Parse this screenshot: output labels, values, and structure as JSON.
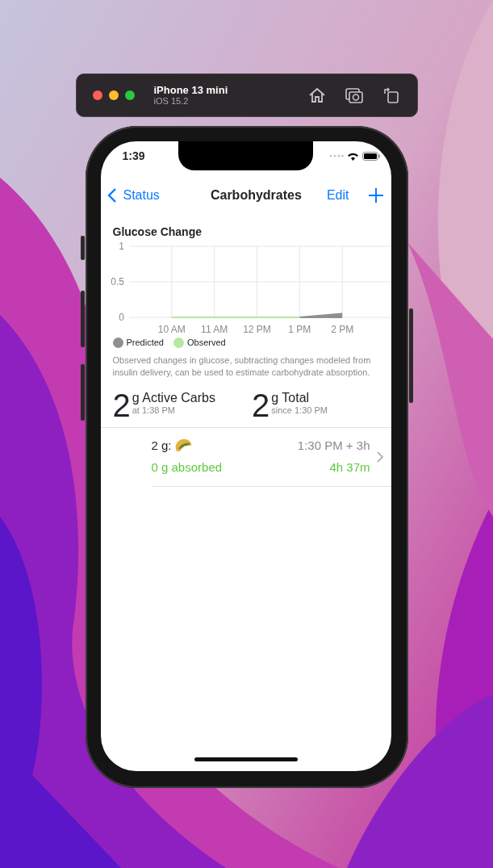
{
  "simulator": {
    "device": "iPhone 13 mini",
    "os": "iOS 15.2"
  },
  "status_bar": {
    "time": "1:39"
  },
  "nav": {
    "back": "Status",
    "title": "Carbohydrates",
    "edit": "Edit"
  },
  "glucose": {
    "title": "Glucose Change",
    "chart_data": {
      "type": "area",
      "grid": true,
      "categories": [
        "10 AM",
        "11 AM",
        "12 PM",
        "1 PM",
        "2 PM"
      ],
      "ylim": [
        0,
        1
      ],
      "yticks": [
        0,
        0.5,
        1
      ],
      "series": [
        {
          "name": "Predicted",
          "color": "#8e8e93",
          "values": [
            null,
            null,
            null,
            0,
            0.05
          ]
        },
        {
          "name": "Observed",
          "color": "#b4e89c",
          "values": [
            0,
            0,
            0,
            0,
            null
          ]
        }
      ]
    },
    "description": "Observed changes in glucose, subtracting changes modeled from insulin delivery, can be used to estimate carbohydrate absorption."
  },
  "summary": [
    {
      "value": "2",
      "unit": "g Active Carbs",
      "caption": "at 1:38 PM"
    },
    {
      "value": "2",
      "unit": "g Total",
      "caption": "since 1:30 PM"
    }
  ],
  "entries": [
    {
      "amount": "2 g:",
      "time": "1:30 PM + 3h",
      "absorbed": "0 g absorbed",
      "remaining": "4h 37m"
    }
  ]
}
